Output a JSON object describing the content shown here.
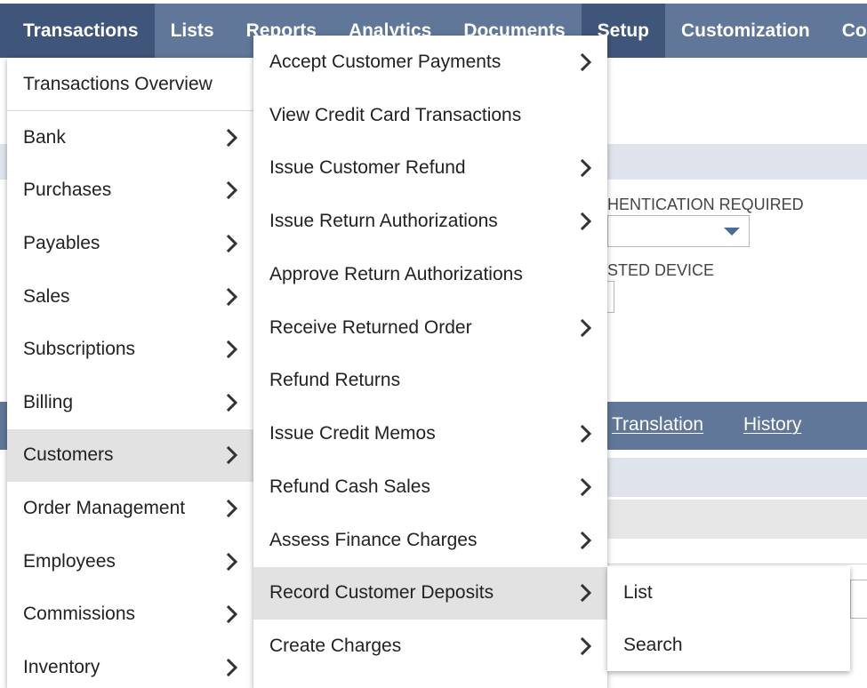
{
  "topnav": {
    "items": [
      "Transactions",
      "Lists",
      "Reports",
      "Analytics",
      "Documents",
      "Setup",
      "Customization",
      "Con"
    ]
  },
  "background": {
    "field1_label": "HENTICATION REQUIRED",
    "field2_label": "STED DEVICE",
    "subnav_links": [
      "Translation",
      "History"
    ]
  },
  "menu1": {
    "overview": "Transactions Overview",
    "items": [
      {
        "label": "Bank",
        "submenu": true
      },
      {
        "label": "Purchases",
        "submenu": true
      },
      {
        "label": "Payables",
        "submenu": true
      },
      {
        "label": "Sales",
        "submenu": true
      },
      {
        "label": "Subscriptions",
        "submenu": true
      },
      {
        "label": "Billing",
        "submenu": true
      },
      {
        "label": "Customers",
        "submenu": true,
        "highlighted": true
      },
      {
        "label": "Order Management",
        "submenu": true
      },
      {
        "label": "Employees",
        "submenu": true
      },
      {
        "label": "Commissions",
        "submenu": true
      },
      {
        "label": "Inventory",
        "submenu": true
      }
    ]
  },
  "menu2": {
    "items": [
      {
        "label": "Accept Customer Payments",
        "submenu": true
      },
      {
        "label": "View Credit Card Transactions",
        "submenu": false
      },
      {
        "label": "Issue Customer Refund",
        "submenu": true
      },
      {
        "label": "Issue Return Authorizations",
        "submenu": true
      },
      {
        "label": "Approve Return Authorizations",
        "submenu": false
      },
      {
        "label": "Receive Returned Order",
        "submenu": true
      },
      {
        "label": "Refund Returns",
        "submenu": false
      },
      {
        "label": "Issue Credit Memos",
        "submenu": true
      },
      {
        "label": "Refund Cash Sales",
        "submenu": true
      },
      {
        "label": "Assess Finance Charges",
        "submenu": true
      },
      {
        "label": "Record Customer Deposits",
        "submenu": true,
        "highlighted": true
      },
      {
        "label": "Create Charges",
        "submenu": true
      }
    ]
  },
  "menu3": {
    "items": [
      {
        "label": "List"
      },
      {
        "label": "Search"
      }
    ]
  },
  "colors": {
    "nav_bg": "#607799",
    "nav_active": "#3f5579",
    "highlight": "#e2e2e2"
  },
  "icons": {
    "submenu": "chevron-right-icon",
    "dropdown": "caret-down-icon"
  }
}
